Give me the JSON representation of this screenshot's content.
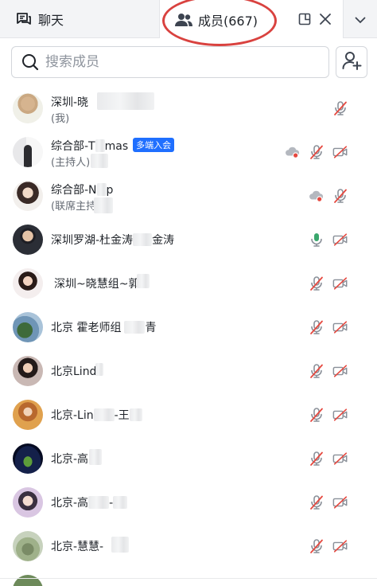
{
  "tabs": {
    "chat": {
      "label": "聊天",
      "icon": "chat-bubbles-icon"
    },
    "members": {
      "label": "成员(667)",
      "icon": "people-icon"
    }
  },
  "tab_actions": [
    "popout-icon",
    "close-icon",
    "chevron-down-icon"
  ],
  "search": {
    "placeholder": "搜索成员",
    "value": ""
  },
  "colors": {
    "danger": "#e5483f",
    "muted_icon": "#8a9099",
    "active_mic": "#3aa76d",
    "badge": "#1f6fff",
    "annotation": "#d9423f"
  },
  "members": [
    {
      "name": "深圳-晓",
      "role": "(我)",
      "badge": "",
      "cloud": false,
      "mic": "muted",
      "cam": "none"
    },
    {
      "name": "综合部-T",
      "name_tail": "mas",
      "role": "(主持人)",
      "badge": "多端入会",
      "cloud": true,
      "mic": "muted",
      "cam": "off"
    },
    {
      "name": "综合部-N",
      "name_tail": "p",
      "role": "(联席主持",
      "badge": "",
      "cloud": true,
      "mic": "muted",
      "cam": "none"
    },
    {
      "name": "深圳罗湖-杜金涛",
      "name_tail": "金涛",
      "role": "",
      "badge": "",
      "cloud": false,
      "mic": "on",
      "cam": "off"
    },
    {
      "name": "深圳~晓慧组~郭",
      "role": "",
      "badge": "",
      "cloud": false,
      "mic": "muted",
      "cam": "off"
    },
    {
      "name": "北京  霍老师组",
      "name_tail": "青",
      "role": "",
      "badge": "",
      "cloud": false,
      "mic": "muted",
      "cam": "off"
    },
    {
      "name": "北京Lind",
      "role": "",
      "badge": "",
      "cloud": false,
      "mic": "muted",
      "cam": "off"
    },
    {
      "name": "北京-Lin",
      "name_tail": "-王",
      "role": "",
      "badge": "",
      "cloud": false,
      "mic": "muted",
      "cam": "off"
    },
    {
      "name": "北京-高",
      "role": "",
      "badge": "",
      "cloud": false,
      "mic": "muted",
      "cam": "off"
    },
    {
      "name": "北京-高",
      "name_tail": "-",
      "role": "",
      "badge": "",
      "cloud": false,
      "mic": "muted",
      "cam": "off"
    },
    {
      "name": "北京-慧慧-",
      "role": "",
      "badge": "",
      "cloud": false,
      "mic": "muted",
      "cam": "off"
    }
  ]
}
